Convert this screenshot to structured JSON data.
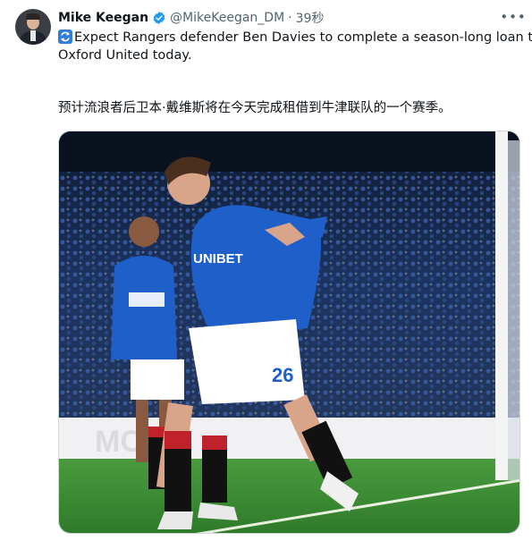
{
  "author": {
    "display_name": "Mike Keegan",
    "handle": "@MikeKeegan_DM",
    "separator": "·",
    "time_ago": "39秒"
  },
  "tweet": {
    "line1": "Expect Rangers defender Ben Davies to complete a season-long loan to",
    "line2": "Oxford United today.",
    "translation": "预计流浪者后卫本·戴维斯将在今天完成租借到牛津联队的一个赛季。"
  },
  "photo": {
    "sponsor_text": "UNIBET",
    "shirt_number": "26"
  },
  "icons": {
    "more": "more-horizontal-icon",
    "verified": "verified-badge-icon",
    "repost": "repost-emoji-icon"
  },
  "colors": {
    "verified_blue": "#1d9bf0",
    "rangers_blue": "#1f5fc9",
    "pitch_green": "#3f8f36"
  }
}
